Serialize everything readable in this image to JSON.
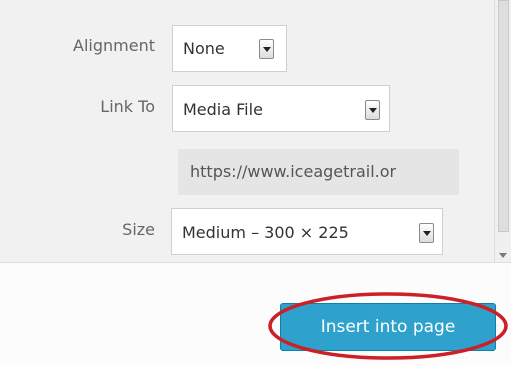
{
  "attachment_display_settings": {
    "alignment": {
      "label": "Alignment",
      "value": "None"
    },
    "link_to": {
      "label": "Link To",
      "value": "Media File"
    },
    "link_url": {
      "value": "https://www.iceagetrail.or"
    },
    "size": {
      "label": "Size",
      "value": "Medium – 300 × 225"
    }
  },
  "footer": {
    "insert_button_label": "Insert into page"
  },
  "annotation": {
    "color": "#cc1f26"
  }
}
